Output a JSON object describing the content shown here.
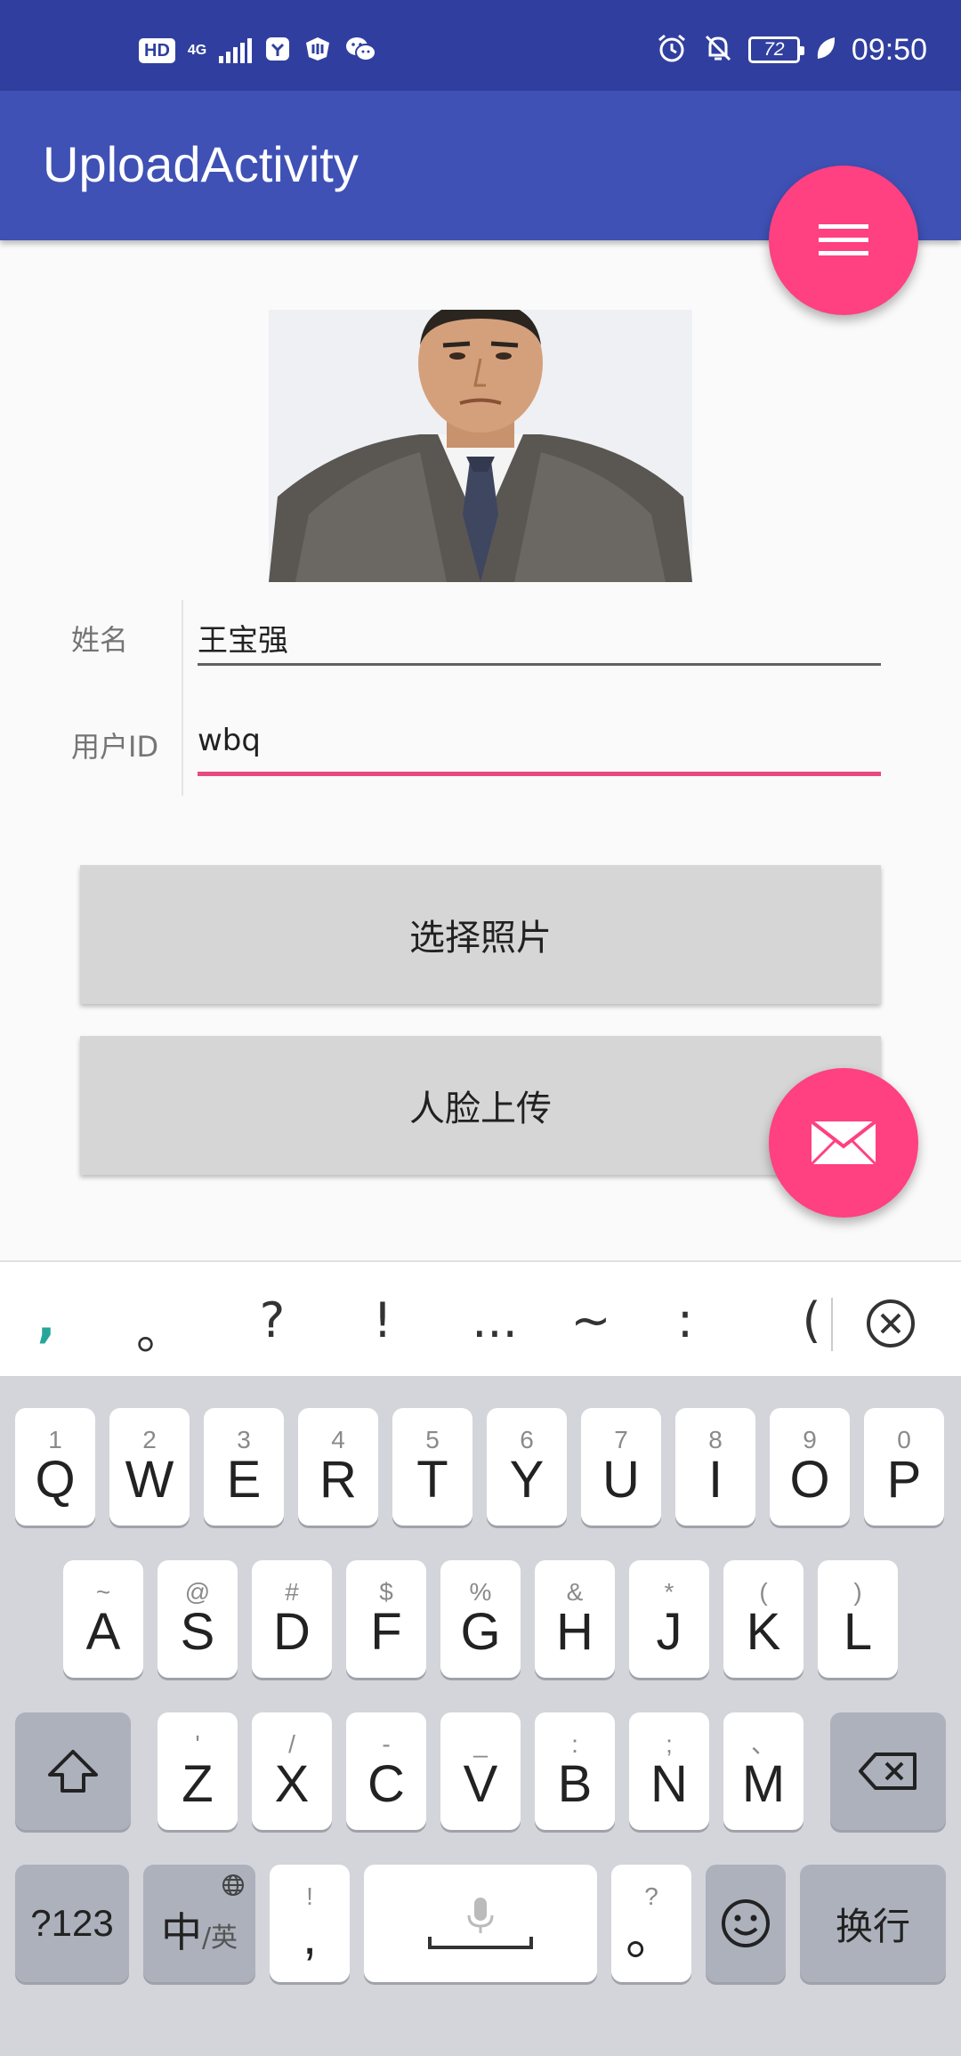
{
  "status_bar": {
    "hd": "HD",
    "network": "4G",
    "battery": "72",
    "time": "09:50"
  },
  "app_bar": {
    "title": "UploadActivity"
  },
  "form": {
    "name_label": "姓名",
    "name_value": "王宝强",
    "uid_label": "用户ID",
    "uid_value": "wbq"
  },
  "buttons": {
    "select_photo": "选择照片",
    "upload_face": "人脸上传"
  },
  "keyboard": {
    "candidates": [
      ",",
      "。",
      "?",
      "!",
      "...",
      "~",
      ":",
      "("
    ],
    "row1": [
      {
        "sub": "1",
        "main": "Q"
      },
      {
        "sub": "2",
        "main": "W"
      },
      {
        "sub": "3",
        "main": "E"
      },
      {
        "sub": "4",
        "main": "R"
      },
      {
        "sub": "5",
        "main": "T"
      },
      {
        "sub": "6",
        "main": "Y"
      },
      {
        "sub": "7",
        "main": "U"
      },
      {
        "sub": "8",
        "main": "I"
      },
      {
        "sub": "9",
        "main": "O"
      },
      {
        "sub": "0",
        "main": "P"
      }
    ],
    "row2": [
      {
        "sub": "~",
        "main": "A"
      },
      {
        "sub": "@",
        "main": "S"
      },
      {
        "sub": "#",
        "main": "D"
      },
      {
        "sub": "$",
        "main": "F"
      },
      {
        "sub": "%",
        "main": "G"
      },
      {
        "sub": "&",
        "main": "H"
      },
      {
        "sub": "*",
        "main": "J"
      },
      {
        "sub": "(",
        "main": "K"
      },
      {
        "sub": ")",
        "main": "L"
      }
    ],
    "row3": [
      {
        "sub": "'",
        "main": "Z"
      },
      {
        "sub": "/",
        "main": "X"
      },
      {
        "sub": "-",
        "main": "C"
      },
      {
        "sub": "_",
        "main": "V"
      },
      {
        "sub": ":",
        "main": "B"
      },
      {
        "sub": ";",
        "main": "N"
      },
      {
        "sub": "、",
        "main": "M"
      }
    ],
    "symbols_key": "?123",
    "lang_key_main": "中",
    "lang_key_sub": "/英",
    "comma_sub": "!",
    "comma_main": ",",
    "period_sub": "?",
    "period_main": "。",
    "enter_key": "换行"
  },
  "colors": {
    "status_bar": "#303f9f",
    "primary": "#3f51b5",
    "accent": "#ff4081"
  }
}
